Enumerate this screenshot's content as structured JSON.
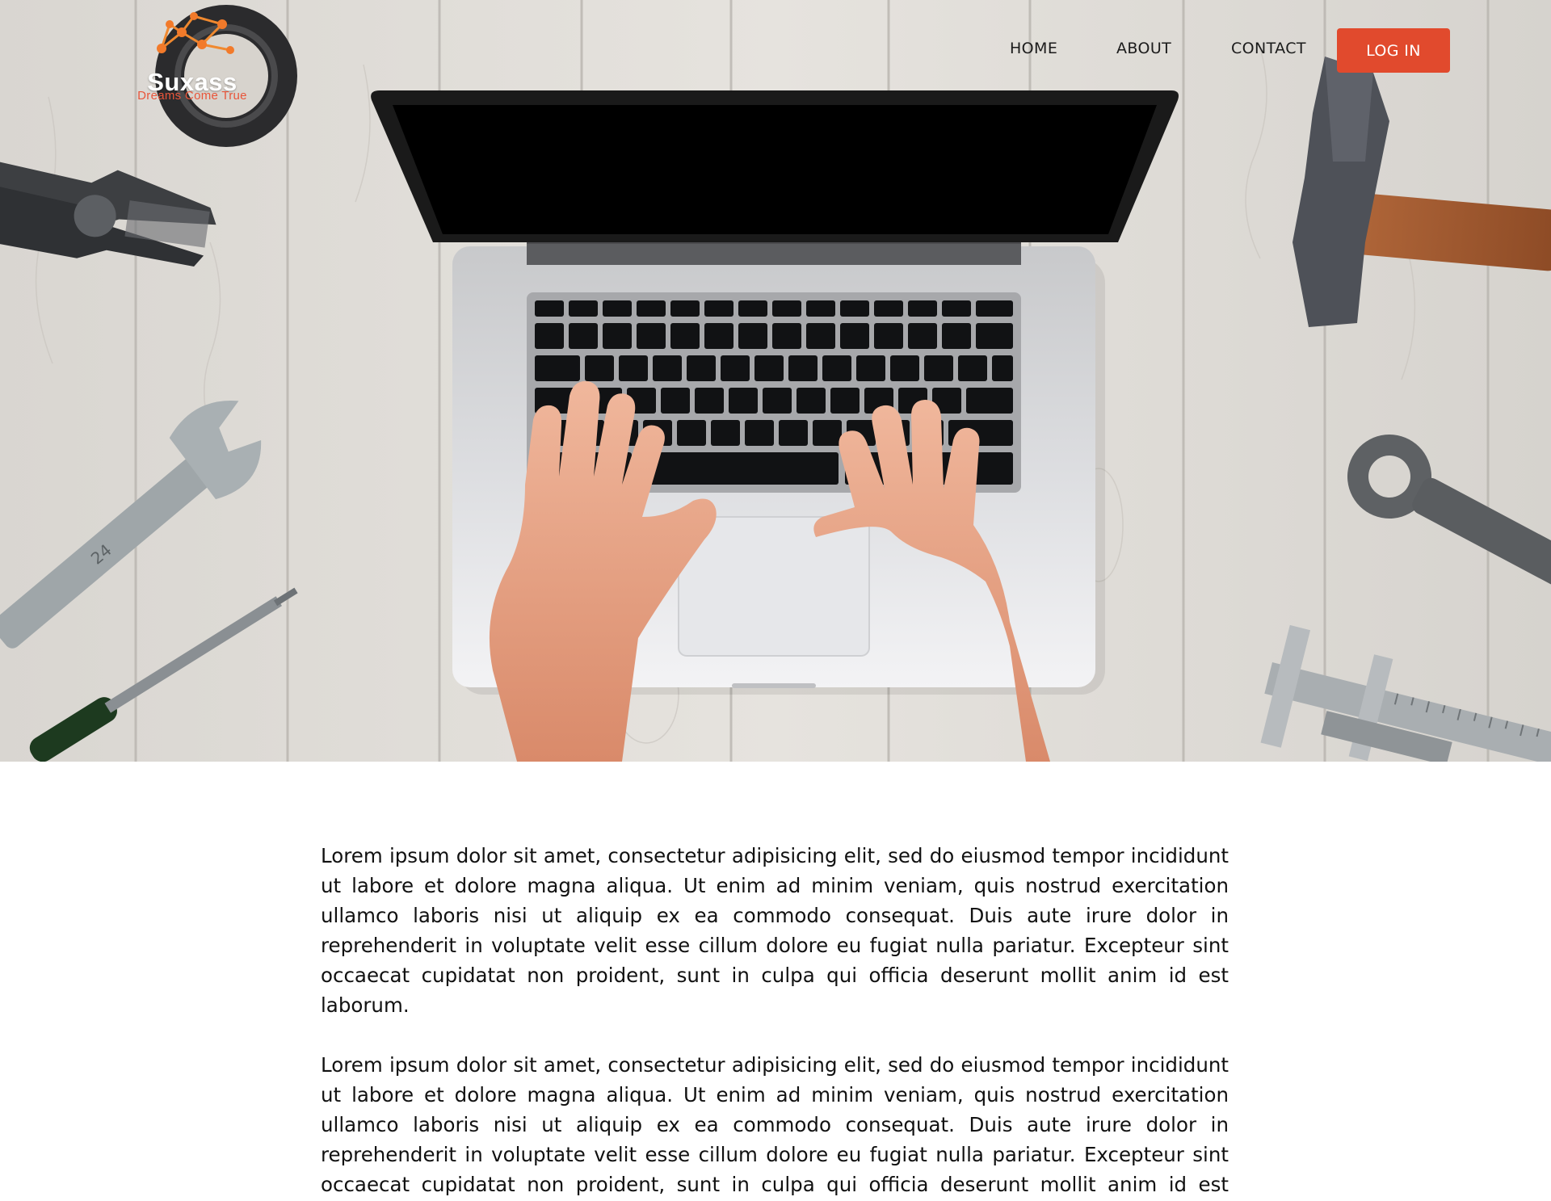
{
  "brand": {
    "name": "Suxass",
    "tagline": "Dreams Come True",
    "accent_color": "#e14a2d"
  },
  "nav": {
    "items": [
      {
        "label": "HOME"
      },
      {
        "label": "ABOUT"
      },
      {
        "label": "CONTACT"
      }
    ],
    "login_label": "LOG IN"
  },
  "hero": {
    "image": "hero-image-laptop-on-wooden-desk-with-tools"
  },
  "content": {
    "paragraphs": [
      "Lorem ipsum dolor sit amet, consectetur adipisicing elit, sed do eiusmod tempor incididunt ut labore et dolore magna aliqua. Ut enim ad minim veniam, quis nostrud exercitation ullamco laboris nisi ut aliquip ex ea commodo consequat. Duis aute irure dolor in reprehenderit in voluptate velit esse cillum dolore eu fugiat nulla pariatur. Excepteur sint occaecat cupidatat non proident, sunt in culpa qui officia deserunt mollit anim id est laborum.",
      "Lorem ipsum dolor sit amet, consectetur adipisicing elit, sed do eiusmod tempor incididunt ut labore et dolore magna aliqua. Ut enim ad minim veniam, quis nostrud exercitation ullamco laboris nisi ut aliquip ex ea commodo consequat. Duis aute irure dolor in reprehenderit in voluptate velit esse cillum dolore eu fugiat nulla pariatur. Excepteur sint occaecat cupidatat non proident, sunt in culpa qui officia deserunt mollit anim id est laborum."
    ]
  }
}
